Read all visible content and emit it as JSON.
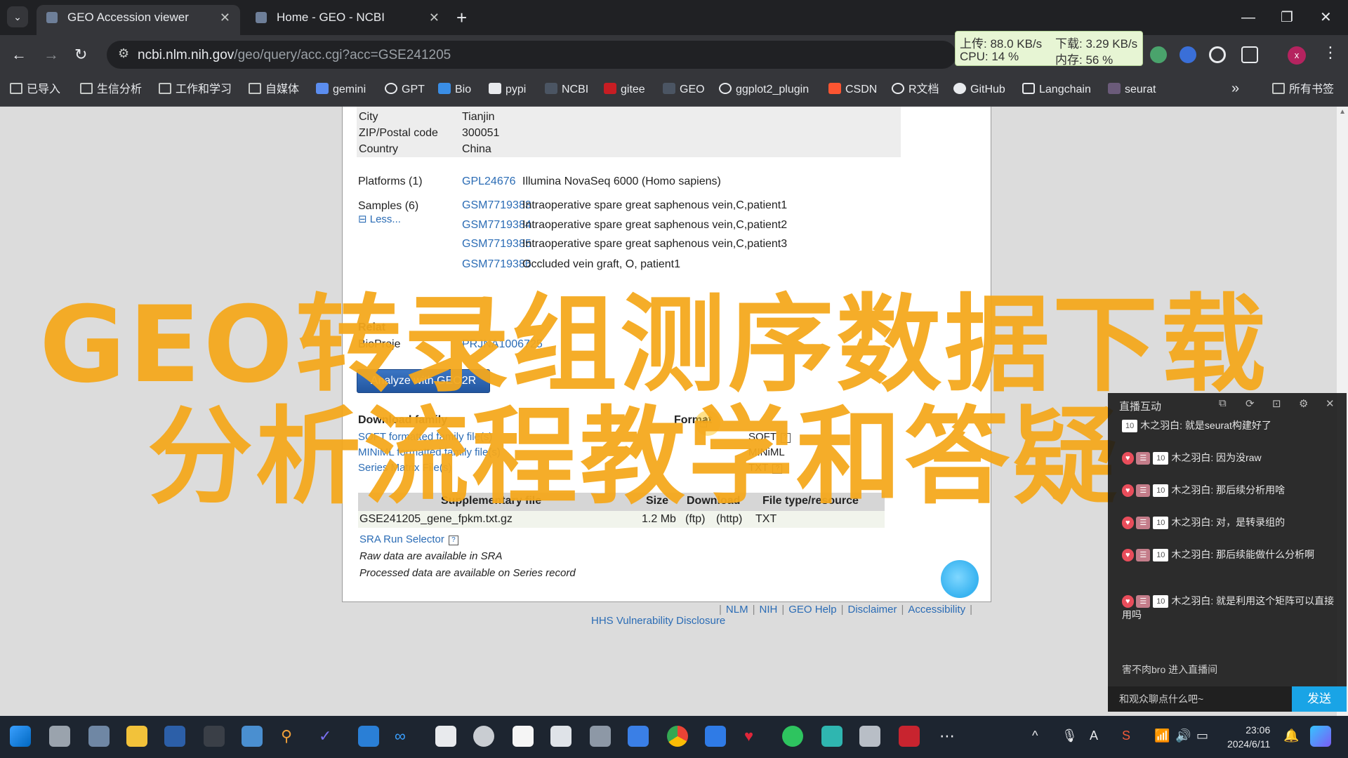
{
  "tabs": [
    {
      "title": "GEO Accession viewer",
      "active": true
    },
    {
      "title": "Home - GEO - NCBI",
      "active": false
    }
  ],
  "window_controls": {
    "minimize": "—",
    "restore": "❐",
    "close": "✕"
  },
  "toolbar": {
    "back": "←",
    "forward": "→",
    "reload": "↻",
    "url_host": "ncbi.nlm.nih.gov",
    "url_path": "/geo/query/acc.cgi?acc=GSE241205"
  },
  "net_monitor": {
    "upload": "上传: 88.0 KB/s",
    "download": "下载: 3.29 KB/s",
    "cpu": "CPU: 14 %",
    "memory": "内存: 56 %"
  },
  "profile_initial": "x",
  "bookmarks": [
    {
      "label": "已导入",
      "icon": "folder-icon"
    },
    {
      "label": "生信分析",
      "icon": "folder-icon"
    },
    {
      "label": "工作和学习",
      "icon": "folder-icon"
    },
    {
      "label": "自媒体",
      "icon": "folder-icon"
    },
    {
      "label": "gemini",
      "icon": "gemini-icon"
    },
    {
      "label": "GPT",
      "icon": "openai-icon"
    },
    {
      "label": "Bio",
      "icon": "bio-icon"
    },
    {
      "label": "pypi",
      "icon": "pypi-icon"
    },
    {
      "label": "NCBI",
      "icon": "ncbi-icon"
    },
    {
      "label": "gitee",
      "icon": "gitee-icon"
    },
    {
      "label": "GEO",
      "icon": "geo-icon"
    },
    {
      "label": "ggplot2_plugin",
      "icon": "globe-icon"
    },
    {
      "label": "CSDN",
      "icon": "csdn-icon"
    },
    {
      "label": "R文档",
      "icon": "globe-icon"
    },
    {
      "label": "GitHub",
      "icon": "github-icon"
    },
    {
      "label": "Langchain",
      "icon": "langchain-icon"
    },
    {
      "label": "seurat",
      "icon": "seurat-icon"
    }
  ],
  "bookmarks_more": "»",
  "bookmarks_all": "所有书签",
  "contact": {
    "city_label": "City",
    "city": "Tianjin",
    "zip_label": "ZIP/Postal code",
    "zip": "300051",
    "country_label": "Country",
    "country": "China"
  },
  "platforms": {
    "label": "Platforms (1)",
    "id": "GPL24676",
    "desc": "Illumina NovaSeq 6000 (Homo sapiens)"
  },
  "samples": {
    "label": "Samples (6)",
    "less": "⊟ Less...",
    "items": [
      {
        "id": "GSM7719383",
        "desc": "Intraoperative spare great saphenous vein,C,patient1"
      },
      {
        "id": "GSM7719384",
        "desc": "Intraoperative spare great saphenous vein,C,patient2"
      },
      {
        "id": "GSM7719385",
        "desc": "Intraoperative spare great saphenous vein,C,patient3"
      },
      {
        "id": "GSM7719386",
        "desc": "Occluded vein graft, O, patient1"
      }
    ]
  },
  "related": {
    "label": "Relat",
    "bioproject_label": "BioProje",
    "bioproject_id": "PRJNA1006725"
  },
  "geo2r_button": "Analyze with GEO2R",
  "download_family": {
    "header": "Download family",
    "format_header": "Format",
    "rows": [
      {
        "label": "SOFT formatted family file(s)",
        "format": "SOFT"
      },
      {
        "label": "MINiML formatted family file(s)",
        "format": "MINiML"
      },
      {
        "label": "Series Matrix File(s)",
        "format": "TXT"
      }
    ]
  },
  "supplementary": {
    "headers": [
      "Supplementary file",
      "Size",
      "Download",
      "File type/resource"
    ],
    "rows": [
      {
        "file": "GSE241205_gene_fpkm.txt.gz",
        "size": "1.2 Mb",
        "download_ftp": "(ftp)",
        "download_http": "(http)",
        "type": "TXT"
      }
    ],
    "sra_selector": "SRA Run Selector",
    "raw_note": "Raw data are available in SRA",
    "processed_note": "Processed data are available on Series record"
  },
  "footer": {
    "links": [
      "NLM",
      "NIH",
      "GEO Help",
      "Disclaimer",
      "Accessibility"
    ],
    "hhs": "HHS Vulnerability Disclosure"
  },
  "overlay": {
    "line1": "GEO转录组测序数据下载",
    "line2": "分析流程教学和答疑"
  },
  "chat": {
    "title": "直播互动",
    "messages": [
      {
        "badge": "10",
        "text": "木之羽白: 就是seurat构建好了"
      },
      {
        "badge": "10",
        "text": "木之羽白: 因为没raw"
      },
      {
        "badge": "10",
        "text": "木之羽白: 那后续分析用啥"
      },
      {
        "badge": "10",
        "text": "木之羽白: 对，是转录组的"
      },
      {
        "badge": "10",
        "text": "木之羽白: 那后续能做什么分析啊"
      },
      {
        "badge": "10",
        "text": "木之羽白: 就是利用这个矩阵可以直接用吗"
      }
    ],
    "join_notice": "害不肉bro 进入直播间",
    "input_placeholder": "和观众聊点什么吧~",
    "send": "发送"
  },
  "clock": {
    "time": "23:06",
    "date": "2024/6/11"
  },
  "colors": {
    "accent_link": "#2b6cb5",
    "overlay_text": "#f5a81c",
    "send_button": "#19a4e6"
  }
}
